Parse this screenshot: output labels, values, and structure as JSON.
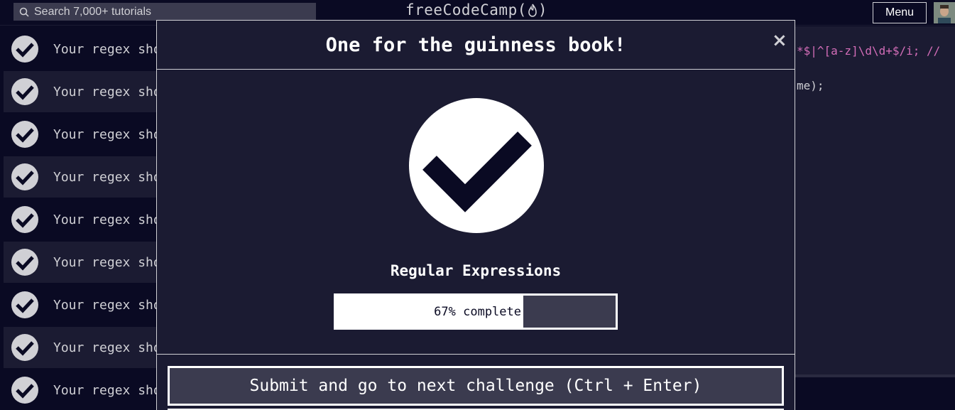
{
  "nav": {
    "search_placeholder": "Search 7,000+ tutorials",
    "brand_prefix": "freeCodeCamp(",
    "brand_suffix": ")",
    "menu_label": "Menu"
  },
  "tests": {
    "items": [
      "Your regex sho",
      "Your regex sho",
      "Your regex sho",
      "Your regex sho",
      "Your regex sho",
      "Your regex sho",
      "Your regex sho",
      "Your regex sho",
      "Your regex sho"
    ]
  },
  "editor": {
    "line1": "*$|^[a-z]\\d\\d+$/i; //",
    "line2": "me);"
  },
  "modal": {
    "title": "One for the guinness book!",
    "close_symbol": "×",
    "certification": "Regular Expressions",
    "progress_percent": 67,
    "progress_text": "67% complete",
    "submit_label": "Submit and go to next challenge (Ctrl + Enter)"
  },
  "colors": {
    "background": "#0a0a23",
    "panel": "#1b1b32",
    "button": "#3b3b4f",
    "text": "#d0d0d5",
    "regex_pink": "#d36db8"
  },
  "icons": [
    "search-icon",
    "flame-icon",
    "check-circle-icon",
    "close-icon"
  ]
}
